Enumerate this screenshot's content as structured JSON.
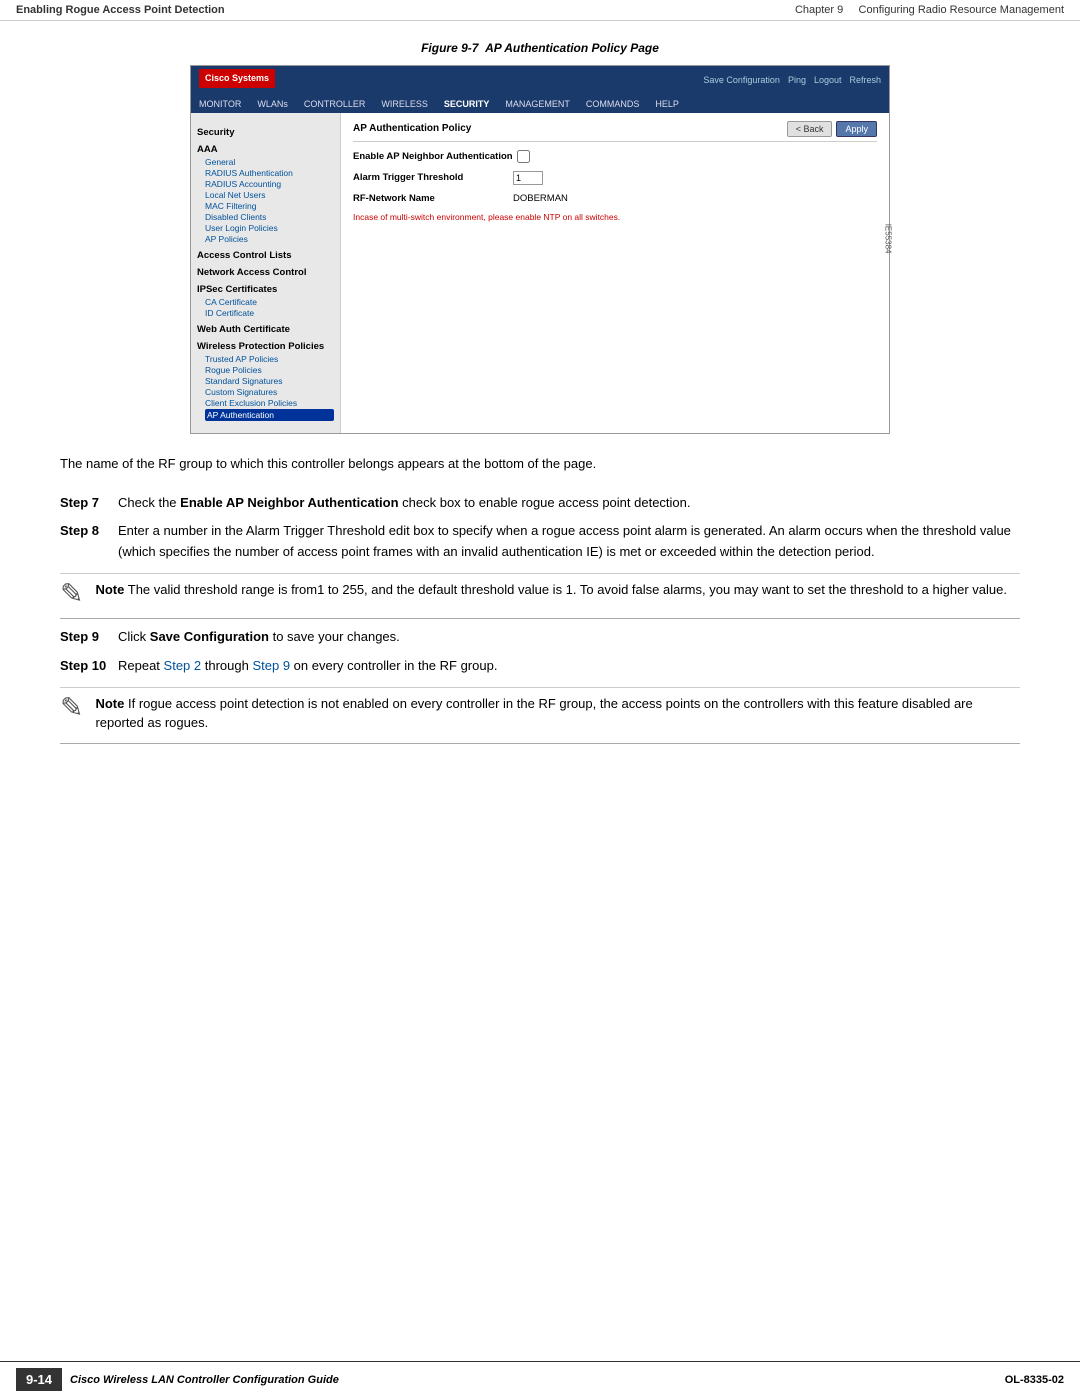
{
  "header": {
    "chapter": "Chapter 9",
    "chapter_title": "Configuring Radio Resource Management",
    "section": "Enabling Rogue Access Point Detection"
  },
  "figure": {
    "number": "Figure 9-7",
    "title": "AP Authentication Policy Page"
  },
  "cisco_ui": {
    "topbar": {
      "logo": "Cisco Systems",
      "links": [
        "Save Configuration",
        "Ping",
        "Logout",
        "Refresh"
      ]
    },
    "navbar": {
      "items": [
        "MONITOR",
        "WLANs",
        "CONTROLLER",
        "WIRELESS",
        "SECURITY",
        "MANAGEMENT",
        "COMMANDS",
        "HELP"
      ]
    },
    "sidebar": {
      "security_label": "Security",
      "sections": [
        {
          "title": "AAA",
          "items": [
            "General",
            "RADIUS Authentication",
            "RADIUS Accounting",
            "Local Net Users",
            "MAC Filtering",
            "Disabled Clients",
            "User Login Policies",
            "AP Policies"
          ]
        },
        {
          "title": "Access Control Lists",
          "items": []
        },
        {
          "title": "Network Access Control",
          "items": []
        },
        {
          "title": "IPSec Certificates",
          "items": [
            "CA Certificate",
            "ID Certificate"
          ]
        },
        {
          "title": "Web Auth Certificate",
          "items": []
        },
        {
          "title": "Wireless Protection Policies",
          "items": [
            "Trusted AP Policies",
            "Rogue Policies",
            "Standard Signatures",
            "Custom Signatures",
            "Client Exclusion Policies",
            "AP Authentication"
          ]
        }
      ]
    },
    "main": {
      "page_title": "AP Authentication Policy",
      "buttons": {
        "back": "< Back",
        "apply": "Apply"
      },
      "fields": [
        {
          "label": "Enable AP Neighbor Authentication",
          "type": "checkbox",
          "value": false
        },
        {
          "label": "Alarm Trigger Threshold",
          "type": "input",
          "value": "1"
        },
        {
          "label": "RF-Network Name",
          "type": "text",
          "value": "DOBERMAN"
        }
      ],
      "note": "Incase of multi-switch environment, please enable NTP on all switches."
    },
    "figure_id": "IE55384"
  },
  "doc_text": {
    "intro": "The name of the RF group to which this controller belongs appears at the bottom of the page.",
    "steps": [
      {
        "number": "Step 7",
        "text": "Check the Enable AP Neighbor Authentication check box to enable rogue access point detection."
      },
      {
        "number": "Step 8",
        "text": "Enter a number in the Alarm Trigger Threshold edit box to specify when a rogue access point alarm is generated. An alarm occurs when the threshold value (which specifies the number of access point frames with an invalid authentication IE) is met or exceeded within the detection period."
      }
    ],
    "note1": {
      "label": "Note",
      "text": "The valid threshold range is from1 to 255, and the default threshold value is 1. To avoid false alarms, you may want to set the threshold to a higher value."
    },
    "steps2": [
      {
        "number": "Step 9",
        "text": "Click Save Configuration to save your changes."
      },
      {
        "number": "Step 10",
        "text": "Repeat Step 2 through Step 9 on every controller in the RF group."
      }
    ],
    "note2": {
      "label": "Note",
      "text": "If rogue access point detection is not enabled on every controller in the RF group, the access points on the controllers with this feature disabled are reported as rogues."
    }
  },
  "footer": {
    "page_number": "9-14",
    "title": "Cisco Wireless LAN Controller Configuration Guide",
    "doc_number": "OL-8335-02"
  }
}
